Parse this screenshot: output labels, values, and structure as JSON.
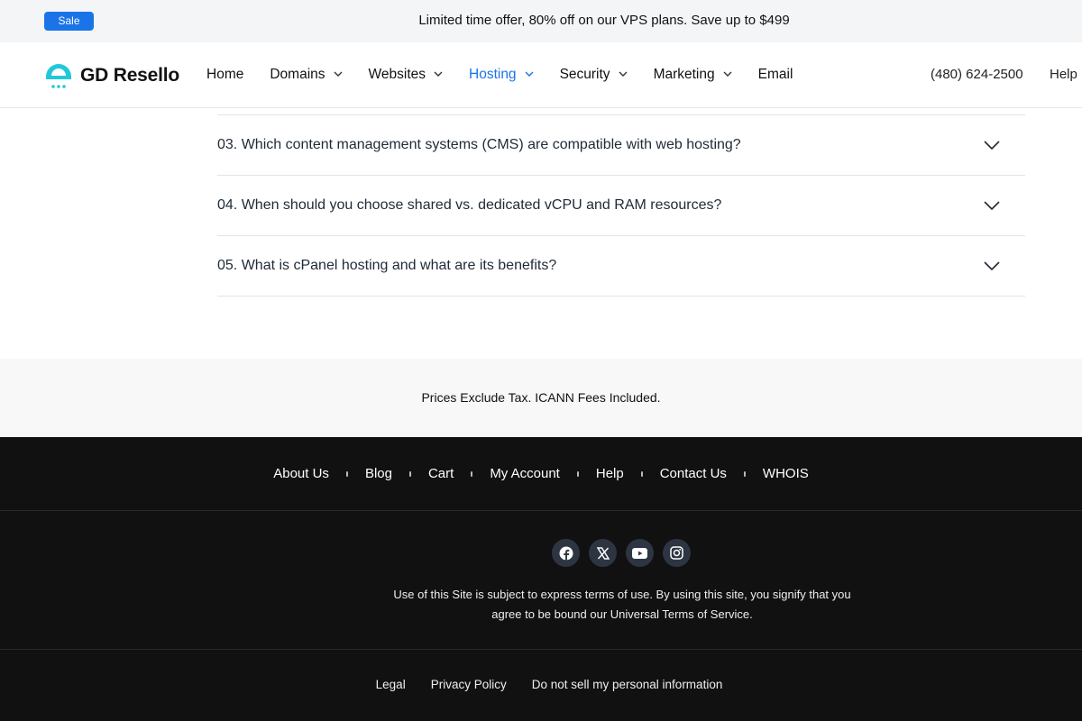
{
  "promo": {
    "badge": "Sale",
    "text": "Limited time offer, 80% off on our VPS plans. Save up to $499"
  },
  "header": {
    "logo_text": "GD Resello",
    "logo_icon": "dome-icon",
    "nav": [
      {
        "label": "Home",
        "dropdown": false,
        "active": false
      },
      {
        "label": "Domains",
        "dropdown": true,
        "active": false
      },
      {
        "label": "Websites",
        "dropdown": true,
        "active": false
      },
      {
        "label": "Hosting",
        "dropdown": true,
        "active": true
      },
      {
        "label": "Security",
        "dropdown": true,
        "active": false
      },
      {
        "label": "Marketing",
        "dropdown": true,
        "active": false
      },
      {
        "label": "Email",
        "dropdown": false,
        "active": false
      }
    ],
    "phone": "(480) 624-2500",
    "help": "Help"
  },
  "faq": [
    {
      "question": "03. Which content management systems (CMS) are compatible with web hosting?"
    },
    {
      "question": "04. When should you choose shared vs. dedicated vCPU and RAM resources?"
    },
    {
      "question": "05. What is cPanel hosting and what are its benefits?"
    }
  ],
  "tax_note": "Prices Exclude Tax. ICANN Fees Included.",
  "footer": {
    "links": [
      "About Us",
      "Blog",
      "Cart",
      "My Account",
      "Help",
      "Contact Us",
      "WHOIS"
    ],
    "social": [
      "facebook-icon",
      "x-icon",
      "youtube-icon",
      "instagram-icon"
    ],
    "legal_line1": "Use of this Site is subject to express terms of use. By using this site, you signify that you",
    "legal_line2": "agree to be bound our Universal Terms of Service.",
    "bottom_links": [
      "Legal",
      "Privacy Policy",
      "Do not sell my personal information"
    ]
  },
  "colors": {
    "accent": "#1a74e8",
    "brand_teal": "#22c8d8",
    "footer_bg": "#111111"
  }
}
